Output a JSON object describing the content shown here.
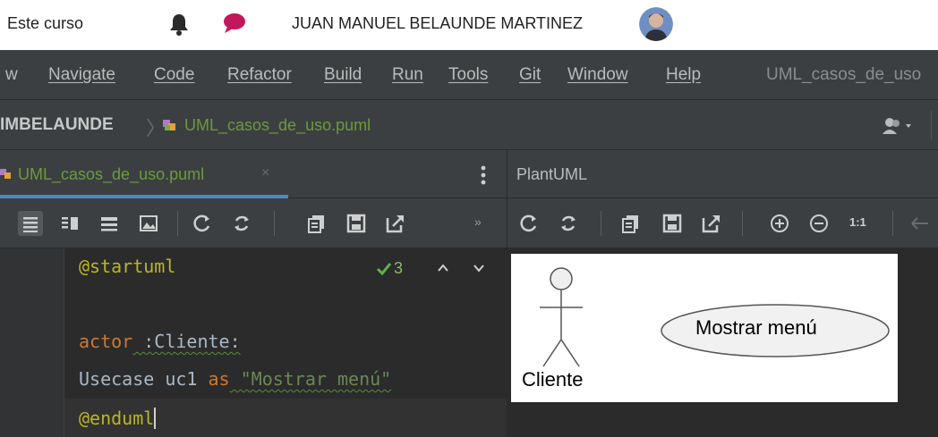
{
  "top_bar": {
    "course_link": "Este curso",
    "icons": [
      "bell-icon",
      "chat-icon"
    ],
    "user_name": "JUAN MANUEL BELAUNDE MARTINEZ",
    "accent_chat": "#c2185b"
  },
  "menu": {
    "items": [
      "w",
      "Navigate",
      "Code",
      "Refactor",
      "Build",
      "Run",
      "Tools",
      "Git",
      "Window",
      "Help"
    ],
    "window_title": "UML_casos_de_uso"
  },
  "breadcrumb": {
    "project": "IMBELAUNDE",
    "file": "UML_casos_de_uso.puml"
  },
  "editor_tab": {
    "label": "UML_casos_de_uso.puml",
    "close": "×"
  },
  "preview_panel": {
    "title": "PlantUML",
    "zoom_label": "1:1"
  },
  "editor_toolbar": {
    "more": "»"
  },
  "editor": {
    "inspection_count": "3",
    "lines": {
      "l1": "@startuml",
      "l3_kw": "actor",
      "l3_rest": " :Cliente:",
      "l4_a": "Usecase uc1 ",
      "l4_kw": "as",
      "l4_str": " \"Mostrar menú\"",
      "l5": "@enduml"
    }
  },
  "diagram": {
    "actor_label": "Cliente",
    "usecase_label": "Mostrar menú"
  },
  "colors": {
    "ide_background": "#2b2b2b",
    "panel": "#3c3f41",
    "file_green": "#6a9b3c",
    "tab_underline": "#4a88c7"
  }
}
